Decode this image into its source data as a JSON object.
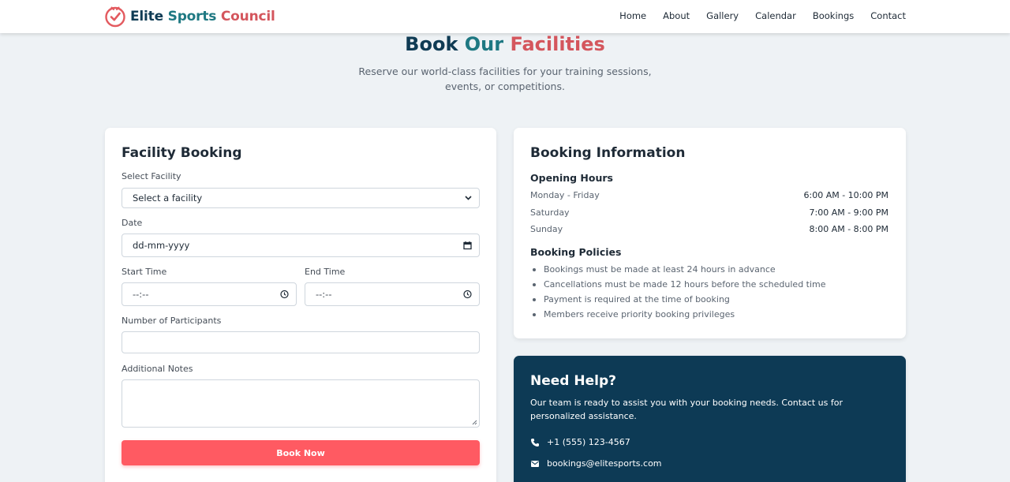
{
  "brand": {
    "part1": "Elite",
    "part2": "Sports",
    "part3": "Council",
    "icon": "check-circle-icon",
    "colors": {
      "navy": "#0f3b54",
      "teal": "#1e7882",
      "coral": "#d4565d"
    }
  },
  "nav": {
    "items": [
      "Home",
      "About",
      "Gallery",
      "Calendar",
      "Bookings",
      "Contact"
    ]
  },
  "hero": {
    "title_part1": "Book",
    "title_part2": "Our",
    "title_part3": "Facilities",
    "subtitle": "Reserve our world-class facilities for your training sessions, events, or competitions."
  },
  "booking_form": {
    "title": "Facility Booking",
    "facility_label": "Select Facility",
    "facility_value": "Select a facility",
    "date_label": "Date",
    "date_placeholder": "dd-mm-yyyy",
    "start_label": "Start Time",
    "start_placeholder": "--:--",
    "end_label": "End Time",
    "end_placeholder": "--:--",
    "participants_label": "Number of Participants",
    "participants_value": "",
    "notes_label": "Additional Notes",
    "notes_value": "",
    "submit_label": "Book Now",
    "button_color": "#ff5a62"
  },
  "booking_info": {
    "title": "Booking Information",
    "hours_heading": "Opening Hours",
    "hours": [
      {
        "day": "Monday - Friday",
        "time": "6:00 AM - 10:00 PM"
      },
      {
        "day": "Saturday",
        "time": "7:00 AM - 9:00 PM"
      },
      {
        "day": "Sunday",
        "time": "8:00 AM - 8:00 PM"
      }
    ],
    "policies_heading": "Booking Policies",
    "policies": [
      "Bookings must be made at least 24 hours in advance",
      "Cancellations must be made 12 hours before the scheduled time",
      "Payment is required at the time of booking",
      "Members receive priority booking privileges"
    ]
  },
  "help": {
    "title": "Need Help?",
    "text": "Our team is ready to assist you with your booking needs. Contact us for personalized assistance.",
    "phone": "+1 (555) 123-4567",
    "email": "bookings@elitesports.com",
    "background": "#0d3a55"
  }
}
